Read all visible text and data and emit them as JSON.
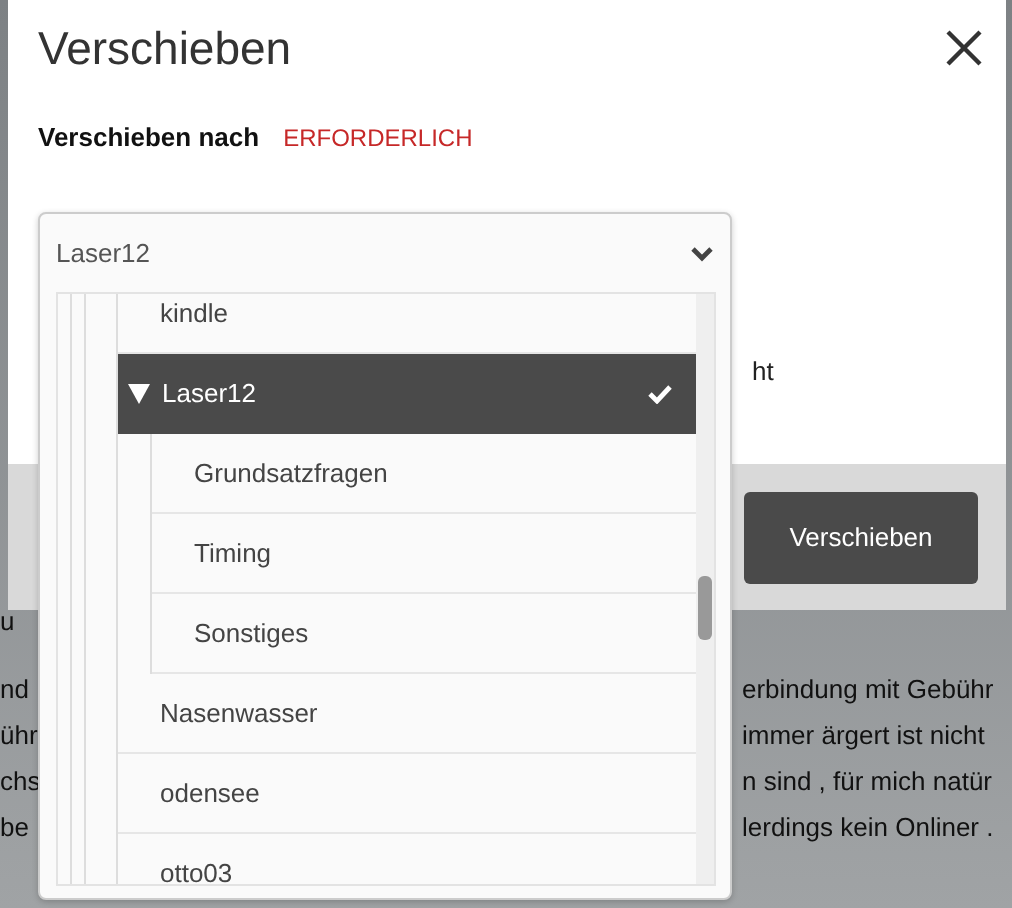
{
  "background_text": {
    "lines": [
      {
        "left": "u"
      },
      {
        "left": "nd",
        "right": "erbindung mit Gebühr"
      },
      {
        "left": "ühr",
        "right": "immer ärgert ist nicht"
      },
      {
        "left": "chs",
        "right": "n sind , für mich natür"
      },
      {
        "left": "be",
        "right": "lerdings kein Onliner ."
      }
    ]
  },
  "dialog": {
    "title": "Verschieben",
    "field_label": "Verschieben nach",
    "required_label": "ERFORDERLICH",
    "body_text_fragment": "ht",
    "submit_button": "Verschieben"
  },
  "select": {
    "value": "Laser12",
    "options": [
      {
        "label": "kindle",
        "selected": false
      },
      {
        "label": "Laser12",
        "selected": true,
        "expanded": true,
        "children": [
          {
            "label": "Grundsatzfragen",
            "selected": false
          },
          {
            "label": "Timing",
            "selected": false
          },
          {
            "label": "Sonstiges",
            "selected": false
          }
        ]
      },
      {
        "label": "Nasenwasser",
        "selected": false
      },
      {
        "label": "odensee",
        "selected": false
      },
      {
        "label": "otto03",
        "selected": false
      }
    ]
  }
}
